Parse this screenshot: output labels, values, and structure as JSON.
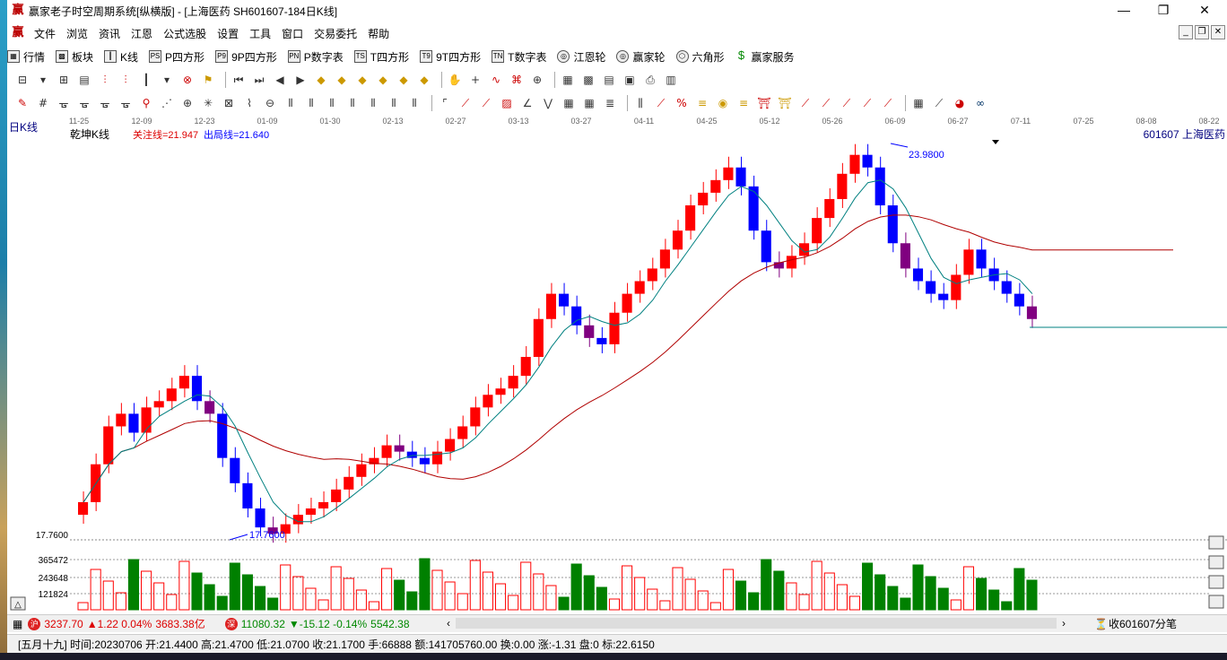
{
  "window": {
    "title": "赢家老子时空周期系统[纵横版] - [上海医药  SH601607-184日K线]",
    "controls": [
      "—",
      "❐",
      "✕"
    ]
  },
  "menu": [
    "文件",
    "浏览",
    "资讯",
    "江恩",
    "公式选股",
    "设置",
    "工具",
    "窗口",
    "交易委托",
    "帮助"
  ],
  "nav": [
    {
      "icon": "table-icon",
      "label": "行情"
    },
    {
      "icon": "blocks-icon",
      "label": "板块"
    },
    {
      "icon": "kline-icon",
      "label": "K线"
    },
    {
      "icon": "ps-icon",
      "label": "P四方形"
    },
    {
      "icon": "p9-icon",
      "label": "9P四方形"
    },
    {
      "icon": "pn-icon",
      "label": "P数字表"
    },
    {
      "icon": "ts-icon",
      "label": "T四方形"
    },
    {
      "icon": "t9-icon",
      "label": "9T四方形"
    },
    {
      "icon": "tn-icon",
      "label": "T数字表"
    },
    {
      "icon": "wheel-icon",
      "label": "江恩轮"
    },
    {
      "icon": "wheel2-icon",
      "label": "赢家轮"
    },
    {
      "icon": "hexagon-icon",
      "label": "六角形"
    },
    {
      "icon": "dollar-icon",
      "label": "赢家服务"
    }
  ],
  "chart": {
    "period_label": "日K线",
    "indicator_name": "乾坤K线",
    "focus_line": "关注线=21.947",
    "exit_line": "出局线=21.640",
    "stock": "601607  上海医药",
    "high_label": "23.9800",
    "low_label": "17.7600",
    "price_axis_label": "17.7600",
    "volume_ticks": [
      "365472",
      "243648",
      "121824"
    ],
    "date_ticks": [
      "11-25",
      "12-09",
      "12-23",
      "01-09",
      "01-30",
      "02-13",
      "02-27",
      "03-13",
      "03-27",
      "04-11",
      "04-25",
      "05-12",
      "05-26",
      "06-09",
      "06-27",
      "07-11",
      "07-25",
      "08-08",
      "08-22"
    ],
    "colors": {
      "up": "#ff0000",
      "down": "#0000ff",
      "violet": "#800080",
      "vol_up": "#ff0000",
      "vol_down": "#008000",
      "ma_long": "#b00000",
      "ma_short": "#008080"
    }
  },
  "chart_data": {
    "type": "candlestick",
    "close_series_approx": [
      18.3,
      18.9,
      19.5,
      19.7,
      19.4,
      19.8,
      19.9,
      20.1,
      20.3,
      19.9,
      19.7,
      19.0,
      18.6,
      18.2,
      17.9,
      17.8,
      17.95,
      18.1,
      18.2,
      18.3,
      18.5,
      18.7,
      18.9,
      19.0,
      19.2,
      19.1,
      19.0,
      18.9,
      19.1,
      19.3,
      19.5,
      19.8,
      20.0,
      20.1,
      20.3,
      20.6,
      21.2,
      21.6,
      21.4,
      21.1,
      20.9,
      20.8,
      21.3,
      21.6,
      21.8,
      22.0,
      22.3,
      22.6,
      23.0,
      23.2,
      23.4,
      23.6,
      23.3,
      22.6,
      22.1,
      22.0,
      22.2,
      22.4,
      22.8,
      23.1,
      23.5,
      23.8,
      23.6,
      23.0,
      22.4,
      22.0,
      21.8,
      21.6,
      21.5,
      21.9,
      22.3,
      22.0,
      21.8,
      21.6,
      21.4,
      21.2
    ],
    "price_high": 23.98,
    "price_low": 17.76,
    "volume_ticks": [
      121824,
      243648,
      365472
    ]
  },
  "status1": {
    "sh_index": "3237.70",
    "sh_change": "▲1.22 0.04%",
    "sh_amount": "3683.38亿",
    "sz_index": "11080.32",
    "sz_change": "▼-15.12 -0.14%",
    "sz_amount": "5542.38",
    "right": "收601607分笔"
  },
  "status2": {
    "info": "[五月十九] 时间:20230706 开:21.4400 高:21.4700 低:21.0700 收:21.1700 手:66888 额:141705760.00 换:0.00 涨:-1.31 盘:0 标:22.6150"
  }
}
